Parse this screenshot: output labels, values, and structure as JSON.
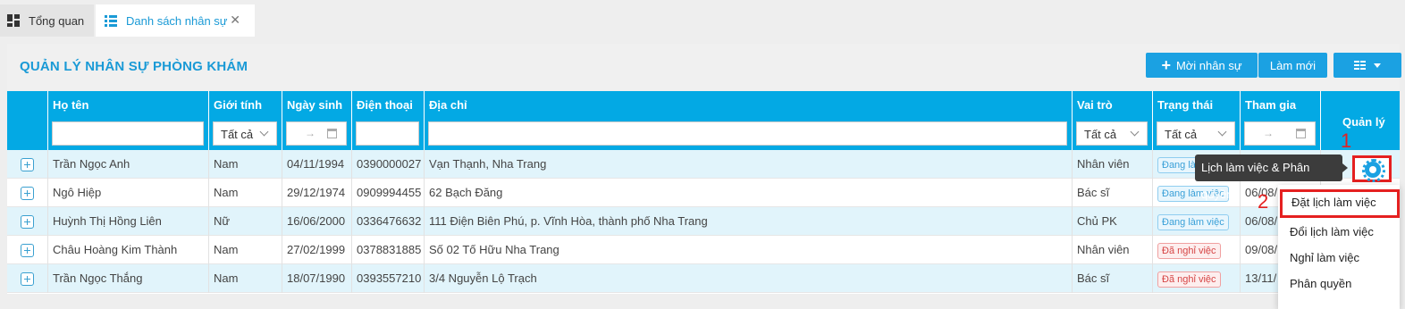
{
  "tabs": [
    {
      "label": "Tổng quan",
      "icon": "dashboard-icon"
    },
    {
      "label": "Danh sách nhân sự",
      "icon": "list-icon",
      "active": true
    }
  ],
  "panel": {
    "title": "QUẢN LÝ NHÂN SỰ PHÒNG KHÁM"
  },
  "toolbar": {
    "add_label": "Mời nhân sự",
    "refresh_label": "Làm mới"
  },
  "columns": {
    "name": "Họ tên",
    "gender": "Giới tính",
    "dob": "Ngày sinh",
    "phone": "Điện thoại",
    "address": "Địa chỉ",
    "role": "Vai trò",
    "status": "Trạng thái",
    "joined": "Tham gia",
    "manage": "Quản lý"
  },
  "filters": {
    "gender": "Tất cả",
    "role": "Tất cả",
    "status": "Tất cả",
    "date_arrow": "→"
  },
  "rows": [
    {
      "name": "Trần Ngọc Anh",
      "gender": "Nam",
      "dob": "04/11/1994",
      "phone": "0390000027",
      "address": "Vạn Thạnh, Nha Trang",
      "role": "Nhân viên",
      "status": "Đang làm việc",
      "joined": ""
    },
    {
      "name": "Ngô Hiệp",
      "gender": "Nam",
      "dob": "29/12/1974",
      "phone": "0909994455",
      "address": "62 Bạch Đăng",
      "role": "Bác sĩ",
      "status": "Đang làm việc",
      "joined": "06/08/"
    },
    {
      "name": "Huỳnh Thị Hồng Liên",
      "gender": "Nữ",
      "dob": "16/06/2000",
      "phone": "0336476632",
      "address": "111 Điện Biên Phú, p. Vĩnh Hòa, thành phố Nha Trang",
      "role": "Chủ PK",
      "status": "Đang làm việc",
      "joined": "06/08/"
    },
    {
      "name": "Châu Hoàng Kim Thành",
      "gender": "Nam",
      "dob": "27/02/1999",
      "phone": "0378831885",
      "address": "Số 02 Tố Hữu Nha Trang",
      "role": "Nhân viên",
      "status": "Đã nghỉ việc",
      "joined": "09/08/"
    },
    {
      "name": "Trần Ngọc Thắng",
      "gender": "Nam",
      "dob": "18/07/1990",
      "phone": "0393557210",
      "address": "3/4 Nguyễn Lộ Trạch",
      "role": "Bác sĩ",
      "status": "Đã nghỉ việc",
      "joined": "13/11/"
    }
  ],
  "tooltip": "Lịch làm việc & Phân quyền",
  "annotations": {
    "one": "1",
    "two": "2"
  },
  "menu": [
    "Đặt lịch làm việc",
    "Đổi lịch làm việc",
    "Nghỉ làm việc",
    "Phân quyền"
  ],
  "colors": {
    "accent": "#1ba1e2",
    "header": "#03a9e4",
    "row_alt": "#e1f4fb",
    "highlight": "#e52020"
  }
}
